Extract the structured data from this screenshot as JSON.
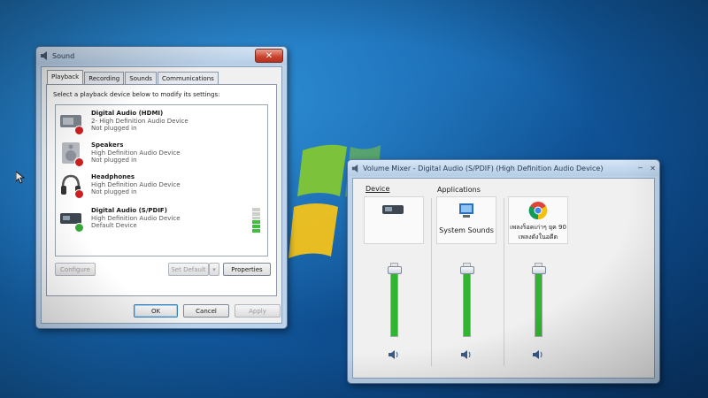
{
  "sound_dialog": {
    "title": "Sound",
    "tabs": [
      "Playback",
      "Recording",
      "Sounds",
      "Communications"
    ],
    "instruction": "Select a playback device below to modify its settings:",
    "devices": [
      {
        "name": "Digital Audio (HDMI)",
        "description": "2- High Definition Audio Device",
        "state": "Not plugged in",
        "icon": "hdmi-device-icon",
        "status": "not-plugged-in"
      },
      {
        "name": "Speakers",
        "description": "High Definition Audio Device",
        "state": "Not plugged in",
        "icon": "speakers-icon",
        "status": "not-plugged-in"
      },
      {
        "name": "Headphones",
        "description": "High Definition Audio Device",
        "state": "Not plugged in",
        "icon": "headphones-icon",
        "status": "not-plugged-in"
      },
      {
        "name": "Digital Audio (S/PDIF)",
        "description": "High Definition Audio Device",
        "state": "Default Device",
        "icon": "spdif-device-icon",
        "status": "default"
      }
    ],
    "buttons": {
      "configure": "Configure",
      "set_default": "Set Default",
      "properties": "Properties",
      "ok": "OK",
      "cancel": "Cancel",
      "apply": "Apply"
    }
  },
  "volume_mixer": {
    "title": "Volume Mixer - Digital Audio (S/PDIF) (High Definition Audio Device)",
    "device_label": "Device",
    "applications_label": "Applications",
    "channels": [
      {
        "name": "",
        "icon": "digital-audio-device-icon",
        "level": 0.92
      },
      {
        "name": "System Sounds",
        "icon": "system-sounds-icon",
        "level": 0.92
      },
      {
        "name": "เพลงร็อคเก่าๆ ยุค 90 เพลงดังในอดีต",
        "icon": "chrome-icon",
        "level": 0.92
      }
    ]
  },
  "colors": {
    "desktop": "#1a6fba",
    "level_green": "#2fb52f",
    "close_red": "#c9412b",
    "logo_green": "#7cc23a",
    "logo_yellow": "#f2c21b"
  }
}
